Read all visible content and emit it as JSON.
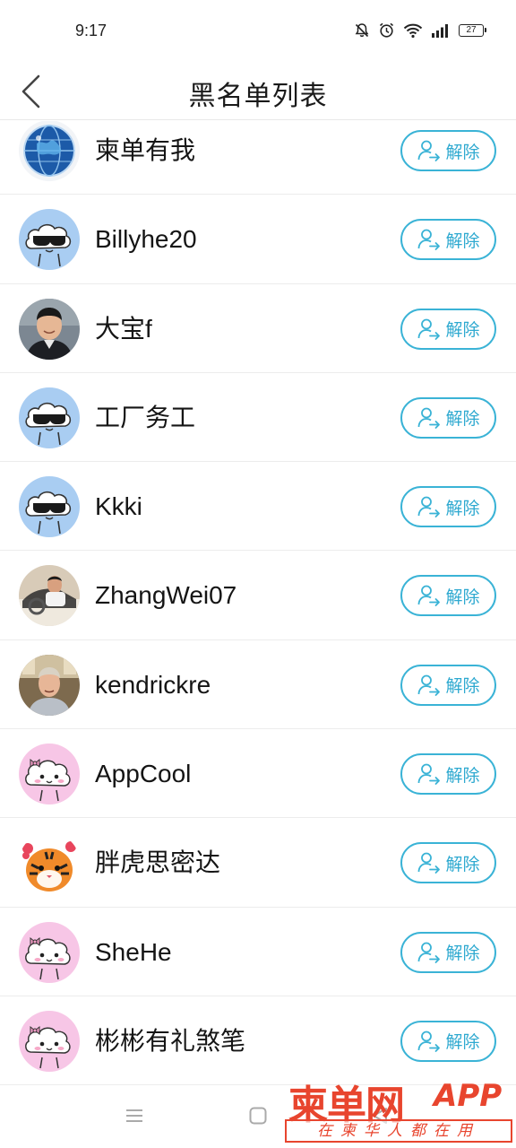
{
  "status_bar": {
    "time": "9:17",
    "battery": "27",
    "icons": [
      "mute-bell-icon",
      "alarm-icon",
      "wifi-icon",
      "signal-icon",
      "battery-icon"
    ]
  },
  "header": {
    "title": "黑名单列表",
    "back_icon": "chevron-left-icon"
  },
  "unblock_label": "解除",
  "unblock_icon": "user-remove-icon",
  "accent_color": "#3ab3d6",
  "users": [
    {
      "name": "柬单有我",
      "avatar": "globe"
    },
    {
      "name": "Billyhe20",
      "avatar": "cloud-sunglasses"
    },
    {
      "name": "大宝f",
      "avatar": "photo-man-suit"
    },
    {
      "name": "工厂务工",
      "avatar": "cloud-sunglasses"
    },
    {
      "name": "Kkki",
      "avatar": "cloud-sunglasses"
    },
    {
      "name": "ZhangWei07",
      "avatar": "photo-car"
    },
    {
      "name": "kendrickre",
      "avatar": "photo-man-office"
    },
    {
      "name": "AppCool",
      "avatar": "cloud-bow-pink"
    },
    {
      "name": "胖虎思密达",
      "avatar": "tiger"
    },
    {
      "name": "SheHe",
      "avatar": "cloud-bow-pink"
    },
    {
      "name": "彬彬有礼煞笔",
      "avatar": "cloud-bow-pink"
    }
  ],
  "nav_bar": {
    "buttons": [
      "menu-icon",
      "home-square-icon",
      "back-triangle-icon"
    ]
  },
  "watermark": {
    "logo": "柬单网",
    "app": "APP",
    "slogan": "在柬华人都在用"
  }
}
